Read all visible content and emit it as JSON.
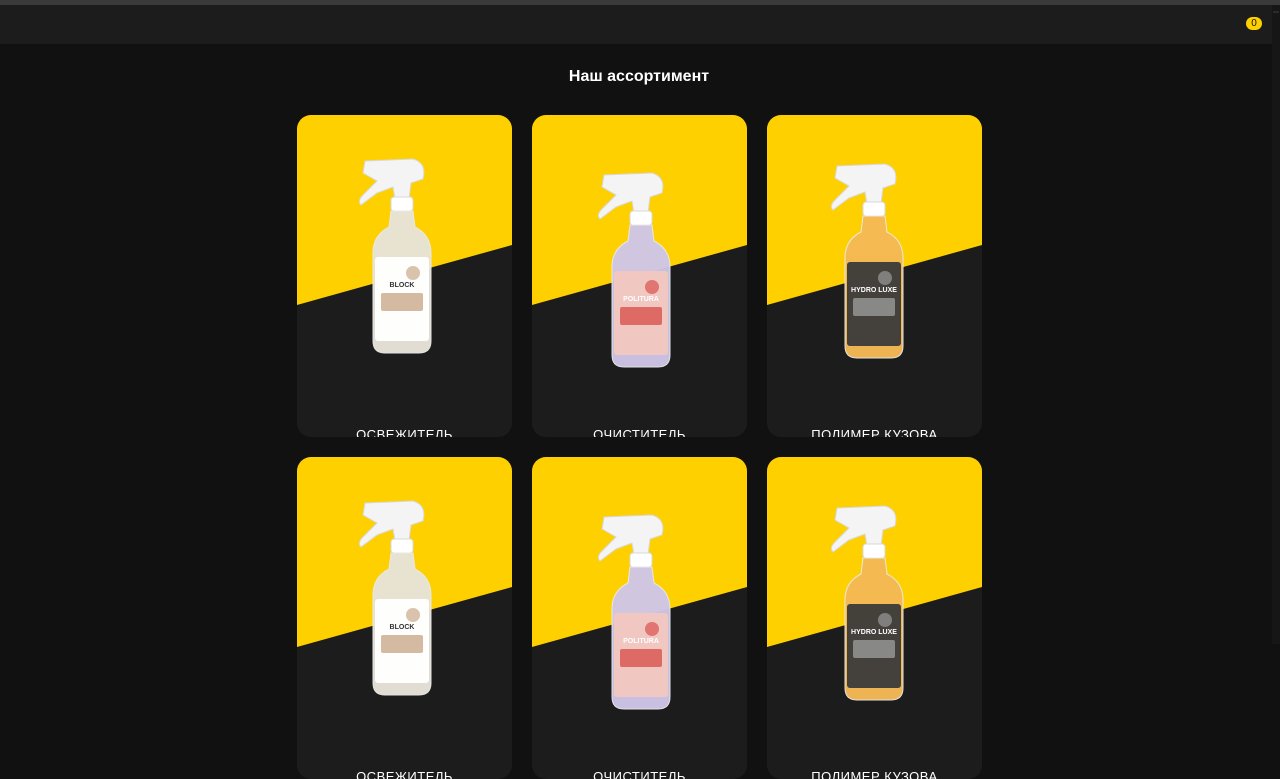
{
  "header": {
    "cart_count": "0",
    "cart_icon": "cart-icon"
  },
  "section": {
    "title": "Наш ассортимент"
  },
  "products": [
    {
      "name": "ОСВЕЖИТЕЛЬ",
      "brand_text": "BLOCK",
      "liquid": "#e8e4d8",
      "label_color": "#ffffff",
      "accent": "#c9a98a"
    },
    {
      "name": "ОЧИСТИТЕЛЬ",
      "brand_text": "POLITURA",
      "liquid": "#cfc6e8",
      "label_color": "#f3c7c0",
      "accent": "#d9534f"
    },
    {
      "name": "ПОЛИМЕР КУЗОВА",
      "brand_text": "HYDRO LUXE",
      "liquid": "#f5b955",
      "label_color": "#3a3a3a",
      "accent": "#9a9a9a"
    },
    {
      "name": "ОСВЕЖИТЕЛЬ",
      "brand_text": "BLOCK",
      "liquid": "#e8e4d8",
      "label_color": "#ffffff",
      "accent": "#c9a98a"
    },
    {
      "name": "ОЧИСТИТЕЛЬ",
      "brand_text": "POLITURA",
      "liquid": "#cfc6e8",
      "label_color": "#f3c7c0",
      "accent": "#d9534f"
    },
    {
      "name": "ПОЛИМЕР КУЗОВА",
      "brand_text": "HYDRO LUXE",
      "liquid": "#f5b955",
      "label_color": "#3a3a3a",
      "accent": "#9a9a9a"
    }
  ],
  "colors": {
    "accent": "#ffd000",
    "background": "#111111",
    "card_dark": "#1c1c1c"
  }
}
